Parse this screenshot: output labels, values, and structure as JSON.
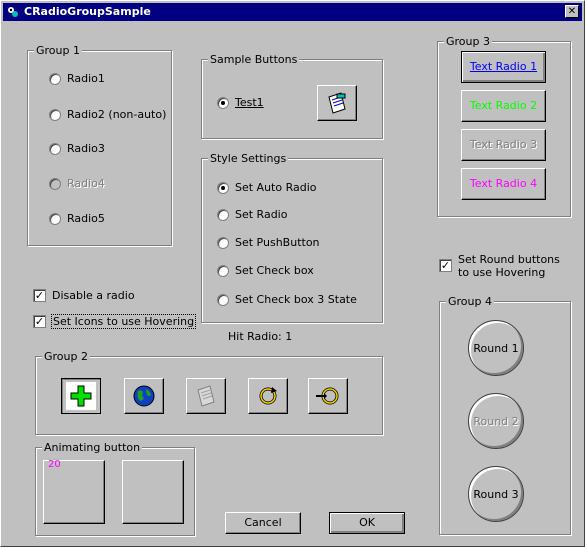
{
  "window": {
    "title": "CRadioGroupSample",
    "close_label": "✕"
  },
  "group1": {
    "label": "Group 1",
    "radios": [
      {
        "label": "Radio1",
        "disabled": false
      },
      {
        "label": "Radio2 (non-auto)",
        "disabled": false
      },
      {
        "label": "Radio3",
        "disabled": false
      },
      {
        "label": "Radio4",
        "disabled": true
      },
      {
        "label": "Radio5",
        "disabled": false
      }
    ]
  },
  "sample_buttons": {
    "label": "Sample Buttons",
    "radio_label": "Test1"
  },
  "style_settings": {
    "label": "Style Settings",
    "options": [
      "Set Auto Radio",
      "Set Radio",
      "Set PushButton",
      "Set Check box",
      "Set Check box 3 State"
    ],
    "selected_index": 0
  },
  "hit_radio_text": "Hit Radio: 1",
  "checks": {
    "disable_radio": "Disable a radio",
    "icons_hover": "Set Icons to use Hovering",
    "round_hover": "Set Round buttons to use Hovering"
  },
  "group2": {
    "label": "Group 2",
    "icons": [
      "plus-icon",
      "globe-icon",
      "notepad-icon",
      "refresh-icon",
      "refresh-arrow-icon"
    ]
  },
  "animating": {
    "label": "Animating button",
    "counter": "20"
  },
  "group3": {
    "label": "Group 3",
    "buttons": [
      {
        "label": "Text Radio 1",
        "color": "#0000ff"
      },
      {
        "label": "Text Radio 2",
        "color": "#00ff00"
      },
      {
        "label": "Text Radio 3",
        "color": "#808080"
      },
      {
        "label": "Text Radio 4",
        "color": "#ff00ff"
      }
    ]
  },
  "group4": {
    "label": "Group 4",
    "buttons": [
      "Round 1",
      "Round 2",
      "Round 3"
    ]
  },
  "footer": {
    "cancel": "Cancel",
    "ok": "OK"
  }
}
